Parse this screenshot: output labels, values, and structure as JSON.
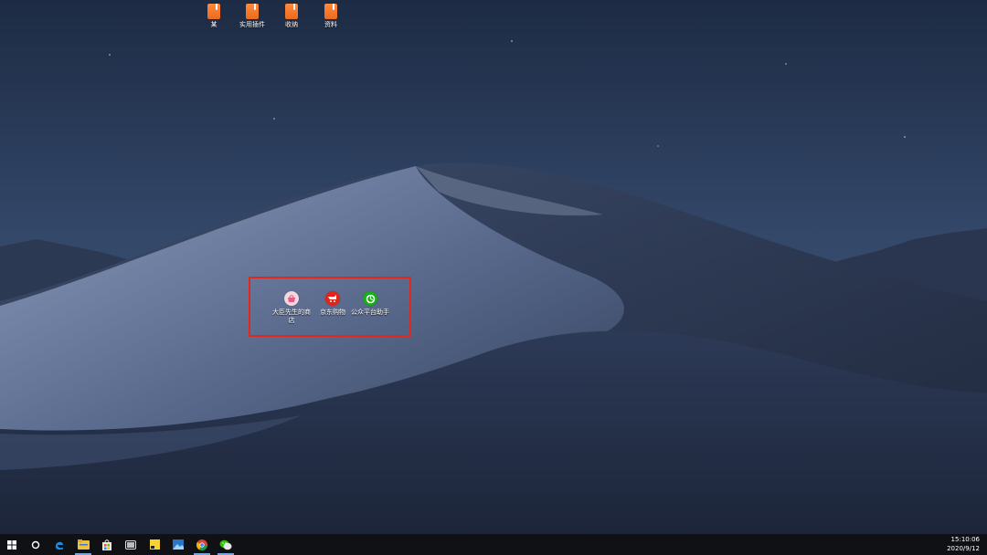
{
  "desktop": {
    "top_icons": [
      {
        "label": "某"
      },
      {
        "label": "实用插件"
      },
      {
        "label": "收纳"
      },
      {
        "label": "资料"
      }
    ],
    "highlighted_icons": [
      {
        "label": "大臣先生的商店",
        "icon": "shop-icon",
        "color": "#f4d8e0"
      },
      {
        "label": "京东购物",
        "icon": "jd-shopping-icon",
        "color": "#e1251b"
      },
      {
        "label": "公众平台助手",
        "icon": "wechat-assistant-icon",
        "color": "#1aad19"
      }
    ],
    "highlight_color": "#e3261e"
  },
  "taskbar": {
    "items": [
      {
        "name": "start-icon"
      },
      {
        "name": "cortana-icon"
      },
      {
        "name": "edge-icon"
      },
      {
        "name": "file-explorer-icon"
      },
      {
        "name": "store-icon"
      },
      {
        "name": "tablet-icon"
      },
      {
        "name": "sticky-notes-icon"
      },
      {
        "name": "photos-icon"
      },
      {
        "name": "chrome-icon"
      },
      {
        "name": "wechat-icon"
      }
    ],
    "time": "15:10:06",
    "date": "2020/9/12"
  }
}
